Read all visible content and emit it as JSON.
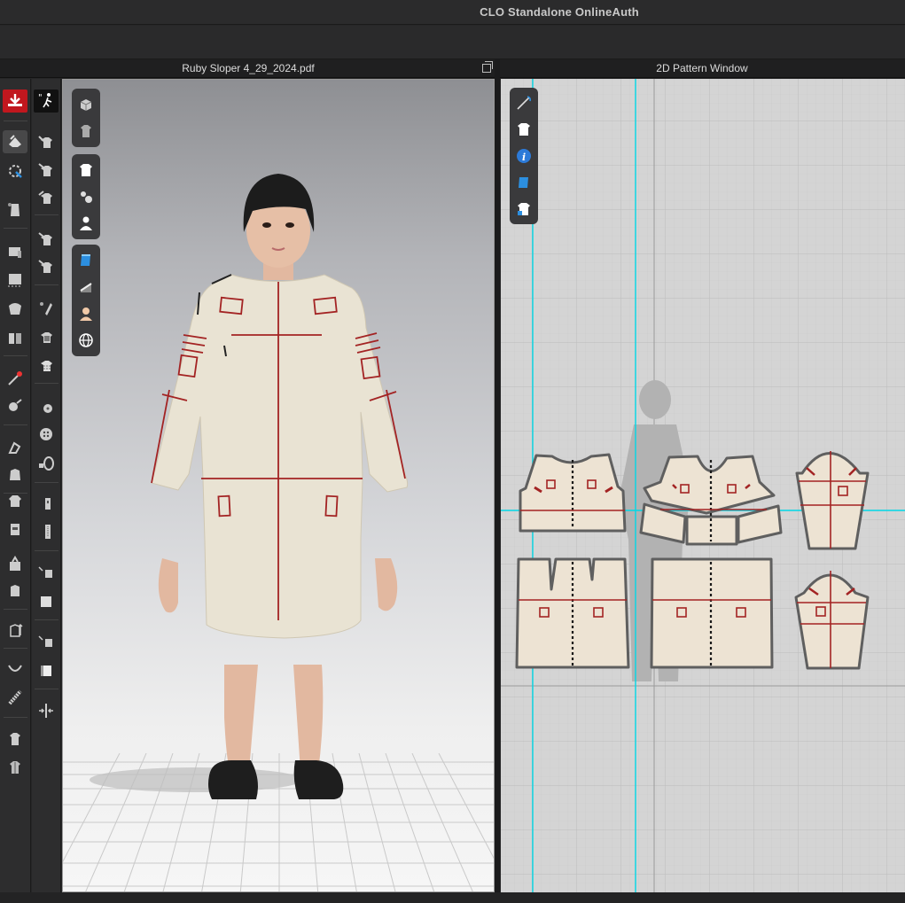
{
  "window": {
    "title": "CLO Standalone OnlineAuth"
  },
  "panels": {
    "view3d": {
      "title": "Ruby Sloper 4_29_2024.pdf"
    },
    "view2d": {
      "title": "2D Pattern Window"
    }
  },
  "toolbar_left": {
    "col1": [
      "simulation-icon",
      "select-move-icon",
      "fold-arrangement-icon",
      "arrangement-point-icon",
      "sewing-machine-icon",
      "topstitch-icon",
      "puckering-icon",
      "fold-icon",
      "pin-icon",
      "tack-icon",
      "zipper-icon",
      "garment-icon",
      "piping-icon",
      "button-icon",
      "ruler-icon",
      "measure-icon",
      "avatar-measure-icon",
      "hanger-icon",
      "garment-fit-icon"
    ],
    "col2": [
      "walk-icon",
      "select-mesh-icon",
      "edit-texture-icon",
      "transform-icon",
      "brush-icon",
      "texture-icon",
      "shader-icon",
      "button-add-icon",
      "buttonhole-icon",
      "zip-icon",
      "rectangle-icon",
      "trim-icon",
      "fabric-icon",
      "fill-icon",
      "mirror-icon"
    ]
  },
  "toolbar_3d_float": [
    "box-view-icon",
    "garment-view-icon",
    "shirt-icon",
    "accessories-icon",
    "avatar-icon",
    "fabric-texture-icon",
    "shading-icon",
    "skin-icon",
    "globe-icon"
  ],
  "toolbar_2d_float": [
    "needle-icon",
    "shirt-icon",
    "info-icon",
    "fabric-icon",
    "pattern-lock-icon"
  ],
  "colors": {
    "accent": "#00d8e6",
    "seam": "#a32323",
    "fabric": "#e6dfcf",
    "avatar_hair": "#1c1c1c"
  }
}
